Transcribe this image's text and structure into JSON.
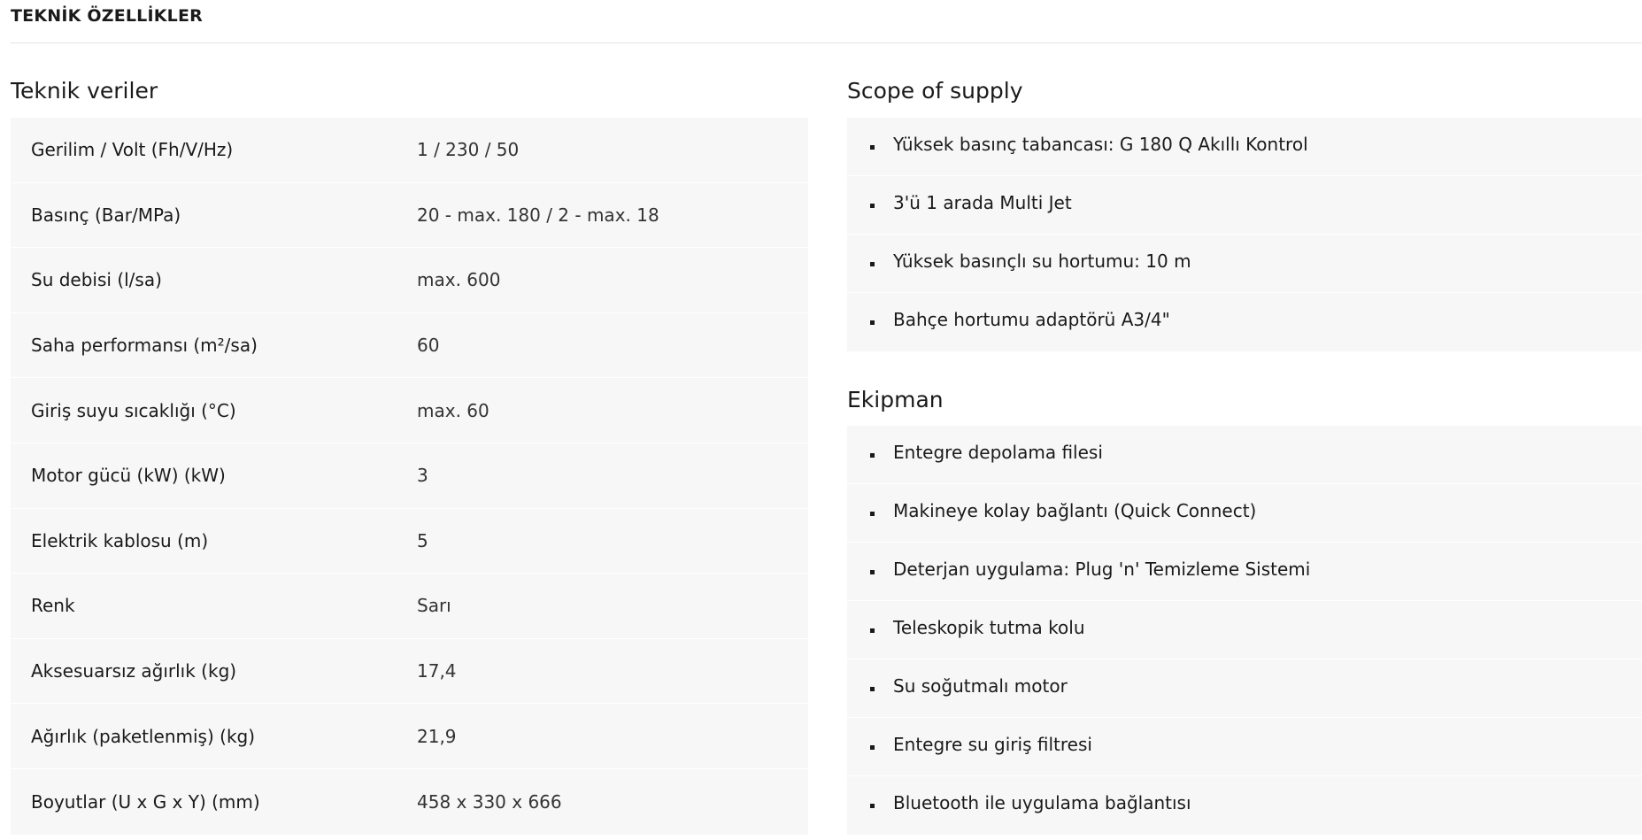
{
  "page": {
    "title": "TEKNİK ÖZELLİKLER"
  },
  "tech_data": {
    "heading": "Teknik veriler",
    "rows": [
      {
        "label": "Gerilim / Volt (Fh/V/Hz)",
        "value": "1 / 230 / 50"
      },
      {
        "label": "Basınç (Bar/MPa)",
        "value": "20 - max. 180 / 2 - max. 18"
      },
      {
        "label": "Su debisi (l/sa)",
        "value": "max. 600"
      },
      {
        "label": "Saha performansı (m²/sa)",
        "value": "60"
      },
      {
        "label": "Giriş suyu sıcaklığı (°C)",
        "value": "max. 60"
      },
      {
        "label": "Motor gücü (kW) (kW)",
        "value": "3"
      },
      {
        "label": "Elektrik kablosu (m)",
        "value": "5"
      },
      {
        "label": "Renk",
        "value": "Sarı"
      },
      {
        "label": "Aksesuarsız ağırlık (kg)",
        "value": "17,4"
      },
      {
        "label": "Ağırlık (paketlenmiş) (kg)",
        "value": "21,9"
      },
      {
        "label": "Boyutlar (U x G x Y) (mm)",
        "value": "458 x 330 x 666"
      }
    ]
  },
  "scope_of_supply": {
    "heading": "Scope of supply",
    "items": [
      "Yüksek basınç tabancası: G 180 Q Akıllı Kontrol",
      "3'ü 1 arada Multi Jet",
      "Yüksek basınçlı su hortumu: 10 m",
      "Bahçe hortumu adaptörü A3/4\""
    ]
  },
  "equipment": {
    "heading": "Ekipman",
    "items": [
      "Entegre depolama filesi",
      "Makineye kolay bağlantı (Quick Connect)",
      "Deterjan uygulama: Plug 'n' Temizleme Sistemi",
      "Teleskopik tutma kolu",
      "Su soğutmalı motor",
      "Entegre su giriş filtresi",
      "Bluetooth ile uygulama bağlantısı"
    ]
  }
}
